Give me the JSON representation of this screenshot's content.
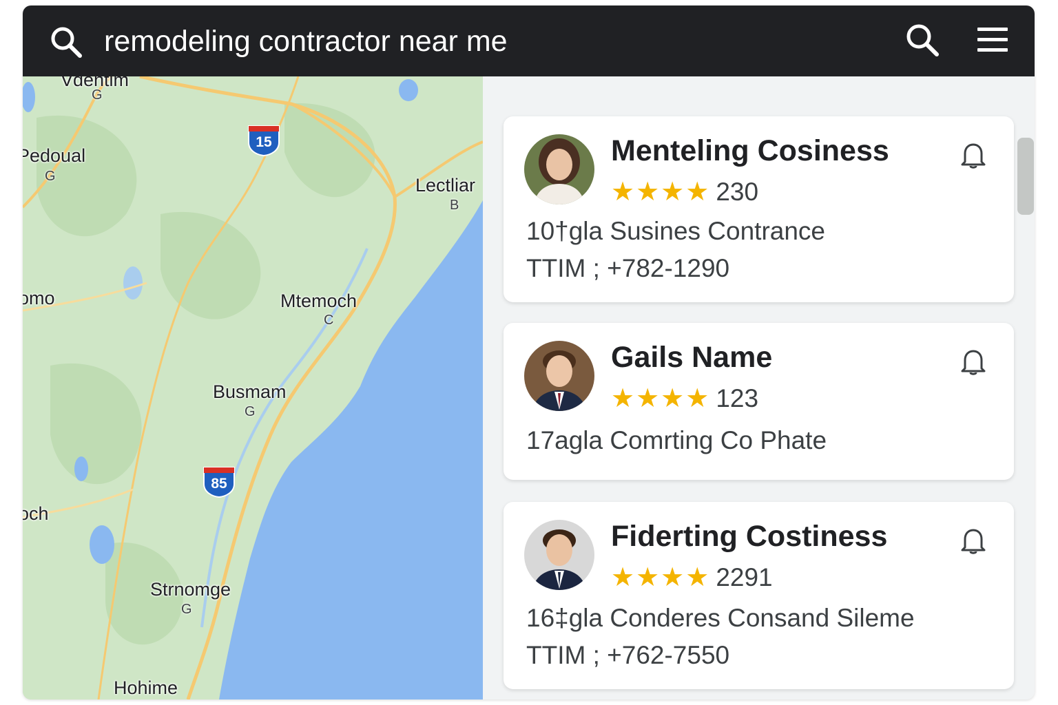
{
  "search": {
    "query": "remodeling contractor near me"
  },
  "colors": {
    "accent_star": "#f4b400",
    "topbar": "#202124",
    "water": "#8ab8f0",
    "land": "#cfe6c6"
  },
  "icons": {
    "search_left": "search-icon",
    "search_right": "search-icon",
    "menu": "hamburger-menu-icon",
    "bell": "bell-icon"
  },
  "map": {
    "places": [
      {
        "name": "Vdentim",
        "sub": "G"
      },
      {
        "name": "Pedoual",
        "sub": "G"
      },
      {
        "name": "Lectliar",
        "sub": "B"
      },
      {
        "name": "omo",
        "sub": ""
      },
      {
        "name": "Mtemoch",
        "sub": "C"
      },
      {
        "name": "Busmam",
        "sub": "G"
      },
      {
        "name": "och",
        "sub": ""
      },
      {
        "name": "Strnomge",
        "sub": "G"
      },
      {
        "name": "Hohime",
        "sub": ""
      }
    ],
    "highways": [
      "15",
      "85"
    ]
  },
  "results": [
    {
      "name": "Menteling Cosiness",
      "stars": 4,
      "rating_count": "230",
      "line1": "10†gla Susines Contrance",
      "line2": "TTIM ; +782-1290"
    },
    {
      "name": "Gails Name",
      "stars": 4,
      "rating_count": "123",
      "line1": "17agla Comrting Co Phate",
      "line2": ""
    },
    {
      "name": "Fiderting Costiness",
      "stars": 4,
      "rating_count": "2291",
      "line1": "16‡gla Conderes Consand Sileme",
      "line2": "TTIM ; +762-7550"
    }
  ]
}
